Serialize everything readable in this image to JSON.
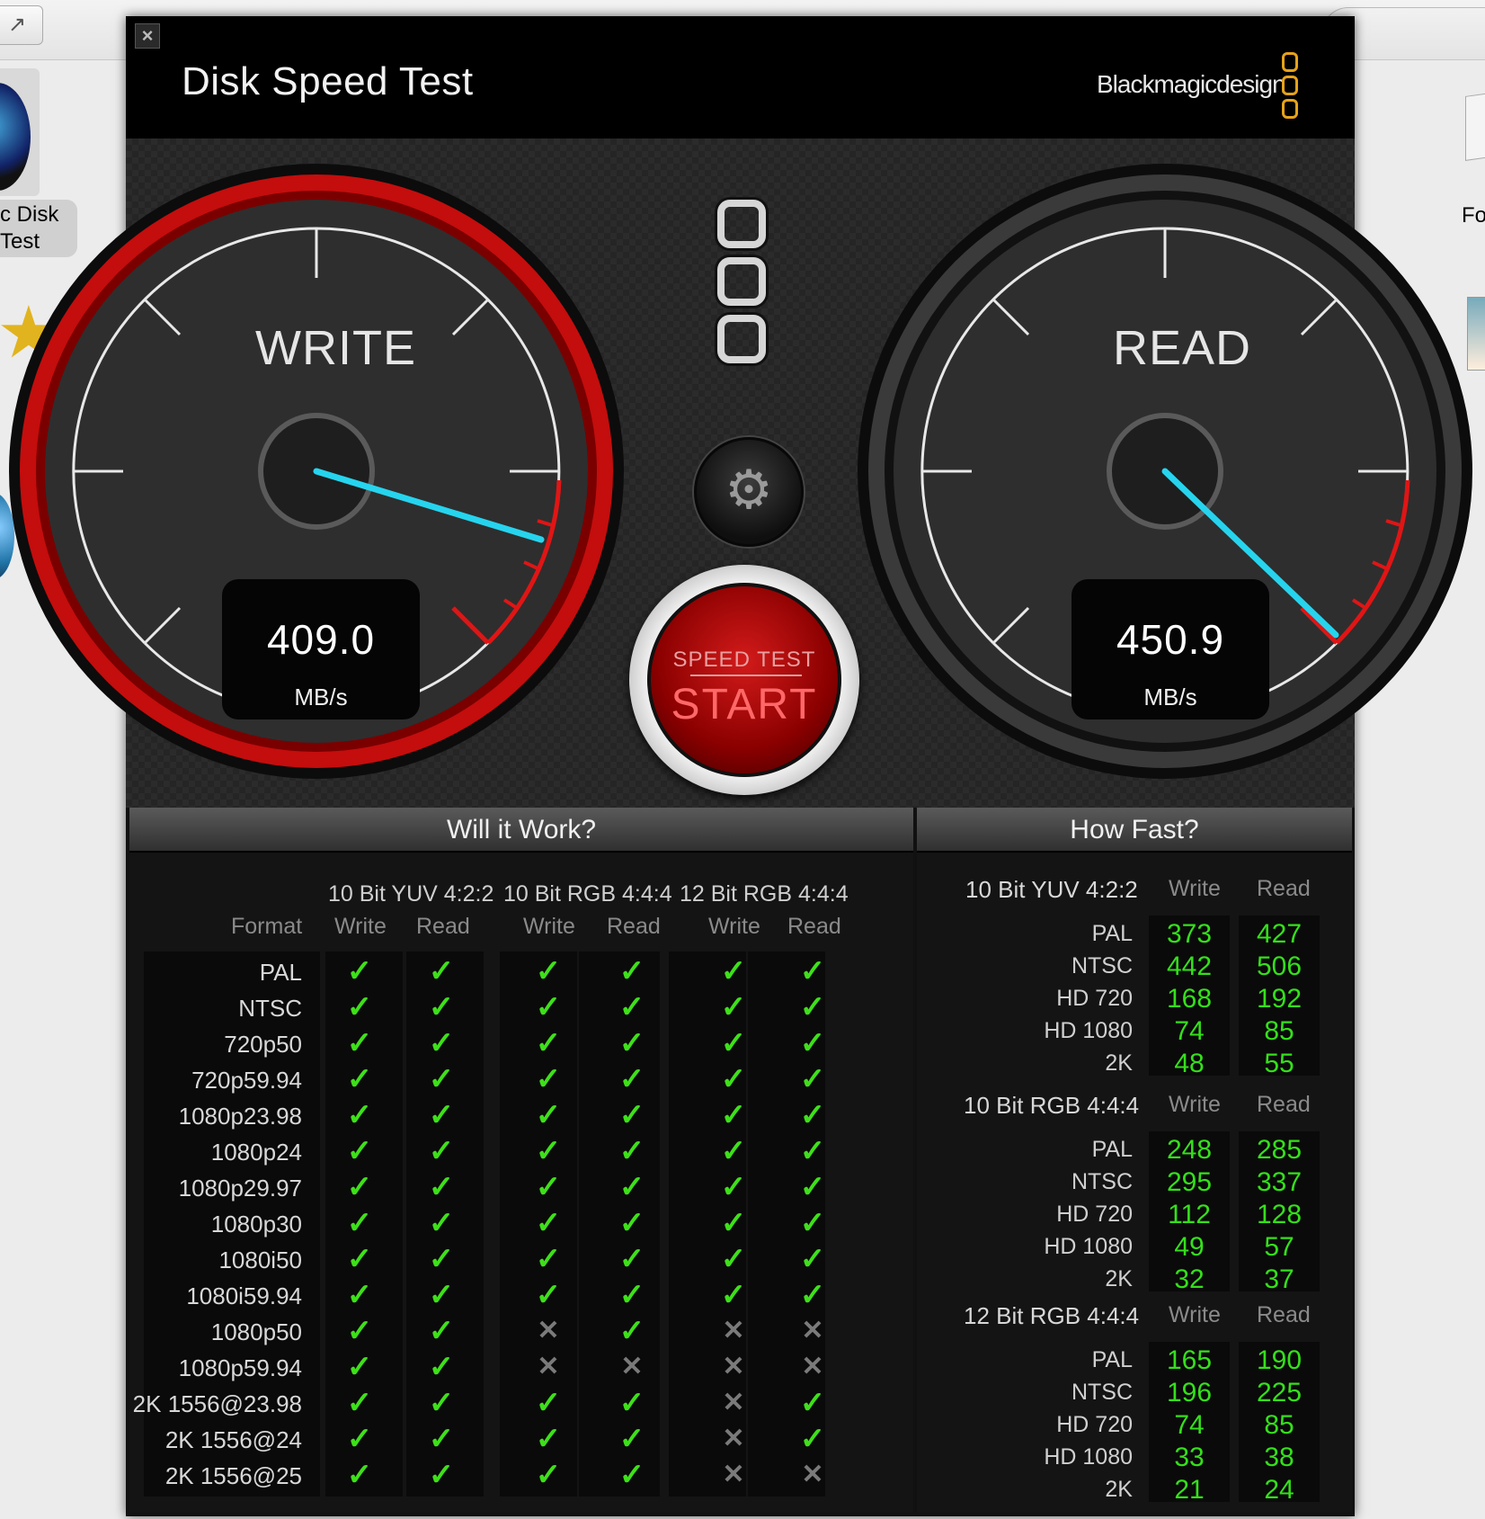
{
  "desktop": {
    "left_icon_label": "c Disk\nTest",
    "right_icon_label": "Fo"
  },
  "window": {
    "title": "Disk Speed Test",
    "brand": "Blackmagicdesign",
    "close_glyph": "×"
  },
  "gauges": {
    "write": {
      "label": "WRITE",
      "value": "409.0",
      "unit": "MB/s"
    },
    "read": {
      "label": "READ",
      "value": "450.9",
      "unit": "MB/s"
    }
  },
  "start_button": {
    "top_label": "SPEED TEST",
    "main_label": "START"
  },
  "settings_icon": "⚙",
  "will_it_work": {
    "title": "Will it Work?",
    "format_header": "Format",
    "groups": [
      "10 Bit YUV 4:2:2",
      "10 Bit RGB 4:4:4",
      "12 Bit RGB 4:4:4"
    ],
    "sub_headers": [
      "Write",
      "Read",
      "Write",
      "Read",
      "Write",
      "Read"
    ],
    "rows": [
      {
        "format": "PAL",
        "marks": [
          1,
          1,
          1,
          1,
          1,
          1
        ]
      },
      {
        "format": "NTSC",
        "marks": [
          1,
          1,
          1,
          1,
          1,
          1
        ]
      },
      {
        "format": "720p50",
        "marks": [
          1,
          1,
          1,
          1,
          1,
          1
        ]
      },
      {
        "format": "720p59.94",
        "marks": [
          1,
          1,
          1,
          1,
          1,
          1
        ]
      },
      {
        "format": "1080p23.98",
        "marks": [
          1,
          1,
          1,
          1,
          1,
          1
        ]
      },
      {
        "format": "1080p24",
        "marks": [
          1,
          1,
          1,
          1,
          1,
          1
        ]
      },
      {
        "format": "1080p29.97",
        "marks": [
          1,
          1,
          1,
          1,
          1,
          1
        ]
      },
      {
        "format": "1080p30",
        "marks": [
          1,
          1,
          1,
          1,
          1,
          1
        ]
      },
      {
        "format": "1080i50",
        "marks": [
          1,
          1,
          1,
          1,
          1,
          1
        ]
      },
      {
        "format": "1080i59.94",
        "marks": [
          1,
          1,
          1,
          1,
          1,
          1
        ]
      },
      {
        "format": "1080p50",
        "marks": [
          1,
          1,
          0,
          1,
          0,
          0
        ]
      },
      {
        "format": "1080p59.94",
        "marks": [
          1,
          1,
          0,
          0,
          0,
          0
        ]
      },
      {
        "format": "2K 1556@23.98",
        "marks": [
          1,
          1,
          1,
          1,
          0,
          1
        ]
      },
      {
        "format": "2K 1556@24",
        "marks": [
          1,
          1,
          1,
          1,
          0,
          1
        ]
      },
      {
        "format": "2K 1556@25",
        "marks": [
          1,
          1,
          1,
          1,
          0,
          0
        ]
      }
    ],
    "ok_glyph": "✓",
    "no_glyph": "✕"
  },
  "how_fast": {
    "title": "How Fast?",
    "col_write": "Write",
    "col_read": "Read",
    "sections": [
      {
        "name": "10 Bit YUV 4:2:2",
        "rows": [
          {
            "format": "PAL",
            "write": "373",
            "read": "427"
          },
          {
            "format": "NTSC",
            "write": "442",
            "read": "506"
          },
          {
            "format": "HD 720",
            "write": "168",
            "read": "192"
          },
          {
            "format": "HD 1080",
            "write": "74",
            "read": "85"
          },
          {
            "format": "2K",
            "write": "48",
            "read": "55"
          }
        ]
      },
      {
        "name": "10 Bit RGB 4:4:4",
        "rows": [
          {
            "format": "PAL",
            "write": "248",
            "read": "285"
          },
          {
            "format": "NTSC",
            "write": "295",
            "read": "337"
          },
          {
            "format": "HD 720",
            "write": "112",
            "read": "128"
          },
          {
            "format": "HD 1080",
            "write": "49",
            "read": "57"
          },
          {
            "format": "2K",
            "write": "32",
            "read": "37"
          }
        ]
      },
      {
        "name": "12 Bit RGB 4:4:4",
        "rows": [
          {
            "format": "PAL",
            "write": "165",
            "read": "190"
          },
          {
            "format": "NTSC",
            "write": "196",
            "read": "225"
          },
          {
            "format": "HD 720",
            "write": "74",
            "read": "85"
          },
          {
            "format": "HD 1080",
            "write": "33",
            "read": "38"
          },
          {
            "format": "2K",
            "write": "21",
            "read": "24"
          }
        ]
      }
    ]
  }
}
